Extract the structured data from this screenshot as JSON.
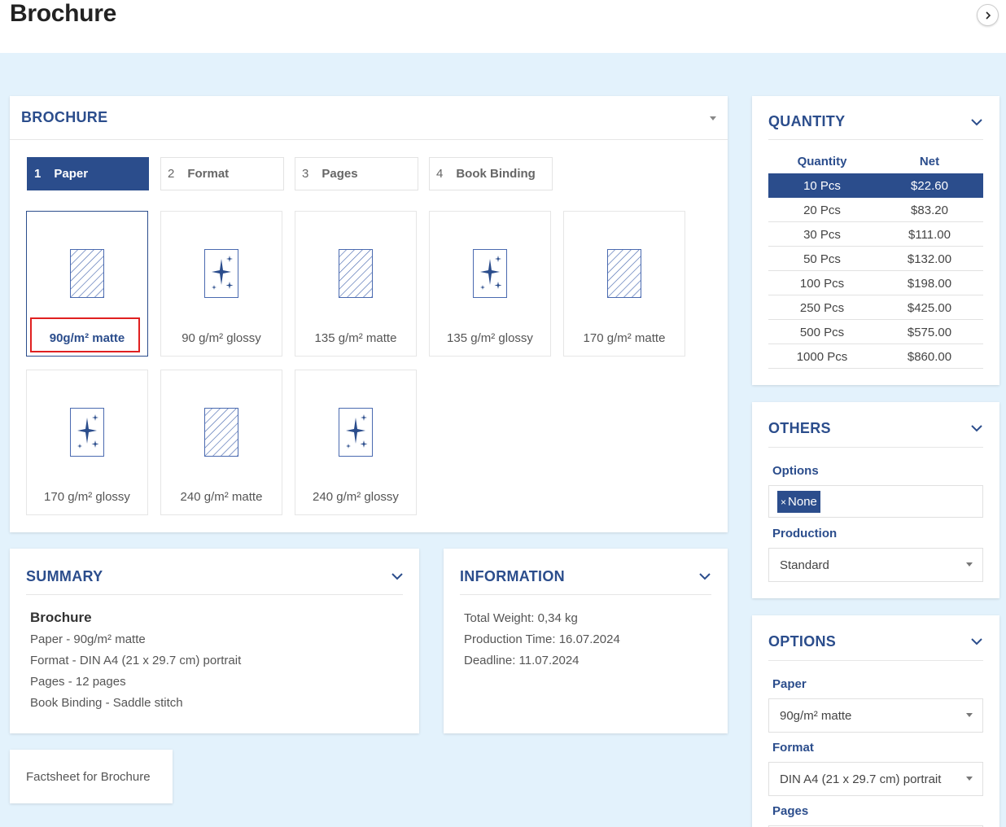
{
  "page": {
    "title": "Brochure",
    "next_icon": "chevron-right-icon"
  },
  "brochure": {
    "title": "BROCHURE",
    "tabs": [
      {
        "num": "1",
        "label": "Paper"
      },
      {
        "num": "2",
        "label": "Format"
      },
      {
        "num": "3",
        "label": "Pages"
      },
      {
        "num": "4",
        "label": "Book Binding"
      }
    ],
    "papers": [
      {
        "label": "90g/m² matte",
        "kind": "matte",
        "selected": true
      },
      {
        "label": "90 g/m² glossy",
        "kind": "glossy"
      },
      {
        "label": "135 g/m² matte",
        "kind": "matte"
      },
      {
        "label": "135 g/m² glossy",
        "kind": "glossy"
      },
      {
        "label": "170 g/m² matte",
        "kind": "matte"
      },
      {
        "label": "170 g/m² glossy",
        "kind": "glossy"
      },
      {
        "label": "240 g/m² matte",
        "kind": "matte"
      },
      {
        "label": "240 g/m² glossy",
        "kind": "glossy"
      }
    ]
  },
  "quantity": {
    "title": "QUANTITY",
    "col_quantity": "Quantity",
    "col_net": "Net",
    "rows": [
      {
        "q": "10 Pcs",
        "p": "$22.60",
        "active": true
      },
      {
        "q": "20 Pcs",
        "p": "$83.20"
      },
      {
        "q": "30 Pcs",
        "p": "$111.00"
      },
      {
        "q": "50 Pcs",
        "p": "$132.00"
      },
      {
        "q": "100 Pcs",
        "p": "$198.00"
      },
      {
        "q": "250 Pcs",
        "p": "$425.00"
      },
      {
        "q": "500 Pcs",
        "p": "$575.00"
      },
      {
        "q": "1000 Pcs",
        "p": "$860.00"
      }
    ]
  },
  "others": {
    "title": "OTHERS",
    "options_label": "Options",
    "options_tag": "None",
    "options_tag_remove": "×",
    "production_label": "Production",
    "production_value": "Standard"
  },
  "options": {
    "title": "OPTIONS",
    "paper_label": "Paper",
    "paper_value": "90g/m² matte",
    "format_label": "Format",
    "format_value": "DIN A4 (21 x 29.7 cm) portrait",
    "pages_label": "Pages"
  },
  "summary": {
    "title": "SUMMARY",
    "heading": "Brochure",
    "lines": [
      "Paper - 90g/m² matte",
      "Format - DIN A4 (21 x 29.7 cm) portrait",
      "Pages - 12 pages",
      "Book Binding - Saddle stitch"
    ]
  },
  "information": {
    "title": "INFORMATION",
    "lines": [
      "Total Weight: 0,34 kg",
      "Production Time: 16.07.2024",
      "Deadline: 11.07.2024"
    ]
  },
  "factsheet": {
    "label": "Factsheet for Brochure"
  },
  "colors": {
    "accent": "#2b4d8c",
    "background": "#e3f2fc",
    "highlight": "#e02020"
  }
}
